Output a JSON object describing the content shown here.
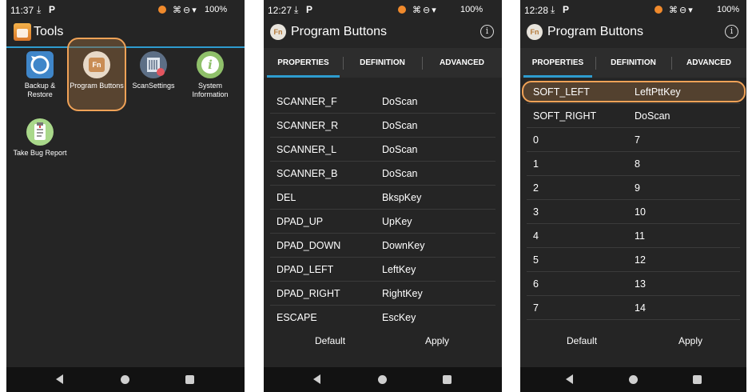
{
  "colors": {
    "accent": "#2e9ccf",
    "highlight": "#f0a257",
    "status_dot": "#f08a2c"
  },
  "phone1": {
    "status": {
      "time": "11:37",
      "battery": "100%"
    },
    "title": "Tools",
    "apps": [
      {
        "name_lines": [
          "Backup &",
          "Restore"
        ]
      },
      {
        "name_lines": [
          "Program Buttons"
        ]
      },
      {
        "name_lines": [
          "ScanSettings"
        ]
      },
      {
        "name_lines": [
          "System",
          "Information"
        ]
      },
      {
        "name_lines": [
          "Take Bug Report"
        ]
      }
    ]
  },
  "phone2": {
    "status": {
      "time": "12:27",
      "battery": "100%"
    },
    "title": "Program Buttons",
    "logo": "Fn",
    "tabs": [
      "PROPERTIES",
      "DEFINITION",
      "ADVANCED"
    ],
    "rows": [
      {
        "key": "SCANNER_F",
        "value": "DoScan"
      },
      {
        "key": "SCANNER_R",
        "value": "DoScan"
      },
      {
        "key": "SCANNER_L",
        "value": "DoScan"
      },
      {
        "key": "SCANNER_B",
        "value": "DoScan"
      },
      {
        "key": "DEL",
        "value": "BkspKey"
      },
      {
        "key": "DPAD_UP",
        "value": "UpKey"
      },
      {
        "key": "DPAD_DOWN",
        "value": "DownKey"
      },
      {
        "key": "DPAD_LEFT",
        "value": "LeftKey"
      },
      {
        "key": "DPAD_RIGHT",
        "value": "RightKey"
      },
      {
        "key": "ESCAPE",
        "value": "EscKey"
      }
    ],
    "footer": {
      "default_label": "Default",
      "apply_label": "Apply"
    }
  },
  "phone3": {
    "status": {
      "time": "12:28",
      "battery": "100%"
    },
    "title": "Program Buttons",
    "logo": "Fn",
    "tabs": [
      "PROPERTIES",
      "DEFINITION",
      "ADVANCED"
    ],
    "rows": [
      {
        "key": "SOFT_LEFT",
        "value": "LeftPttKey"
      },
      {
        "key": "SOFT_RIGHT",
        "value": "DoScan"
      },
      {
        "key": "0",
        "value": "7"
      },
      {
        "key": "1",
        "value": "8"
      },
      {
        "key": "2",
        "value": "9"
      },
      {
        "key": "3",
        "value": "10"
      },
      {
        "key": "4",
        "value": "11"
      },
      {
        "key": "5",
        "value": "12"
      },
      {
        "key": "6",
        "value": "13"
      },
      {
        "key": "7",
        "value": "14"
      }
    ],
    "footer": {
      "default_label": "Default",
      "apply_label": "Apply"
    }
  }
}
